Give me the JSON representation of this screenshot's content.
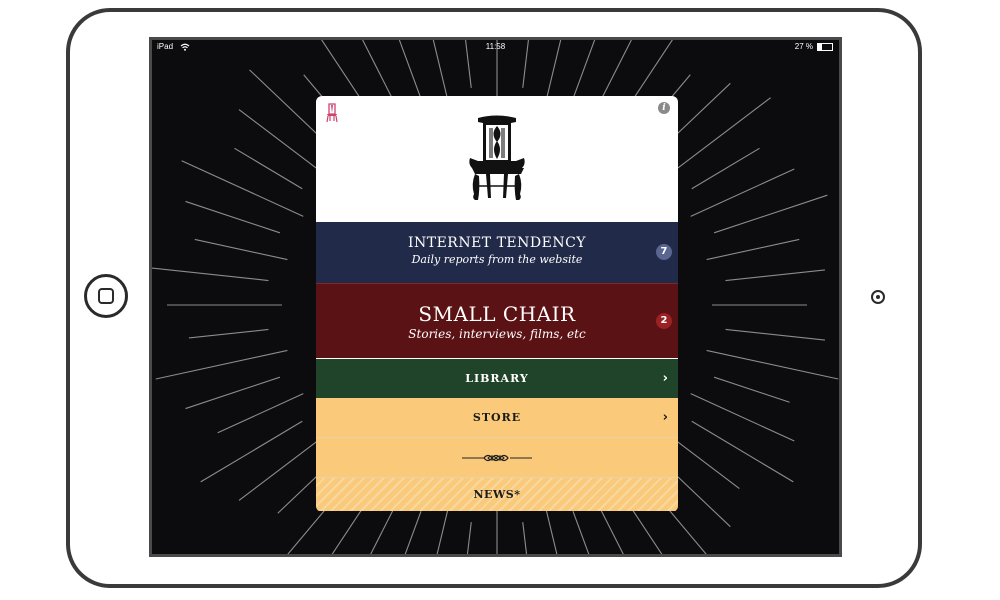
{
  "status_bar": {
    "carrier": "iPad",
    "time": "11:58",
    "battery": "27 %",
    "battery_level": 0.27
  },
  "header": {
    "info_icon_glyph": "i"
  },
  "menu": {
    "internet_tendency": {
      "title": "INTERNET TENDENCY",
      "subtitle": "Daily reports from the website",
      "badge": "7"
    },
    "small_chair": {
      "title": "SMALL CHAIR",
      "subtitle": "Stories, interviews, films, etc",
      "badge": "2"
    },
    "library": {
      "label": "LIBRARY",
      "chevron": "›"
    },
    "store": {
      "label": "STORE",
      "chevron": "›"
    },
    "news": {
      "label": "NEWS*"
    }
  },
  "colors": {
    "screen_bg": "#0c0c0f",
    "internet_tendency_bg": "#212a48",
    "small_chair_bg": "#5b1215",
    "library_bg": "#1f4429",
    "store_bg": "#fac97a",
    "accent_pink": "#d0436e"
  },
  "icons": [
    "wifi-icon",
    "battery-icon",
    "small-chair-icon",
    "info-icon",
    "chair-logo",
    "chevron-right-icon",
    "ornament-divider",
    "home-button",
    "camera-icon"
  ]
}
